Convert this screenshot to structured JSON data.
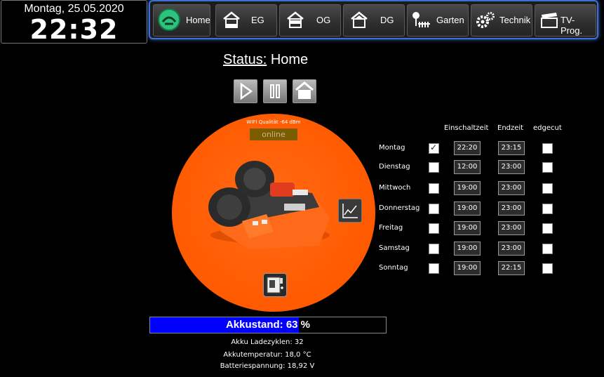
{
  "clock": {
    "date": "Montag, 25.05.2020",
    "time": "22:32"
  },
  "nav": [
    {
      "label": "Home",
      "icon": "mower-icon"
    },
    {
      "label": "EG",
      "icon": "house-icon"
    },
    {
      "label": "OG",
      "icon": "house-icon"
    },
    {
      "label": "DG",
      "icon": "house-icon"
    },
    {
      "label": "Garten",
      "icon": "garden-icon"
    },
    {
      "label": "Technik",
      "icon": "gears-icon"
    },
    {
      "label": "TV-Prog.",
      "icon": "clapper-icon"
    }
  ],
  "status": {
    "key": "Status:",
    "value": "Home"
  },
  "mower": {
    "wifi": "WIFI Qualität -64 dBm",
    "online": "online"
  },
  "schedule": {
    "headers": {
      "start": "Einschaltzeit",
      "end": "Endzeit",
      "edgecut": "edgecut"
    },
    "days": [
      {
        "name": "Montag",
        "enabled": true,
        "start": "22:20",
        "end": "23:15",
        "edgecut": false
      },
      {
        "name": "Dienstag",
        "enabled": false,
        "start": "12:00",
        "end": "23:00",
        "edgecut": false
      },
      {
        "name": "Mittwoch",
        "enabled": false,
        "start": "19:00",
        "end": "23:00",
        "edgecut": false
      },
      {
        "name": "Donnerstag",
        "enabled": false,
        "start": "19:00",
        "end": "23:00",
        "edgecut": false
      },
      {
        "name": "Freitag",
        "enabled": false,
        "start": "19:00",
        "end": "23:00",
        "edgecut": false
      },
      {
        "name": "Samstag",
        "enabled": false,
        "start": "19:00",
        "end": "23:00",
        "edgecut": false
      },
      {
        "name": "Sonntag",
        "enabled": false,
        "start": "19:00",
        "end": "22:15",
        "edgecut": false
      }
    ]
  },
  "battery": {
    "label": "Akkustand: 63 %",
    "percent": 63,
    "fill_color": "#0000ff"
  },
  "info": {
    "cycles": "Akku Ladezyklen: 32",
    "temp": "Akkutemperatur: 18,0 °C",
    "voltage": "Batteriespannung: 18,92 V"
  },
  "colors": {
    "accent": "#3d6fd6",
    "disc": "#ff5a00",
    "online_bg": "#7b5d00"
  }
}
